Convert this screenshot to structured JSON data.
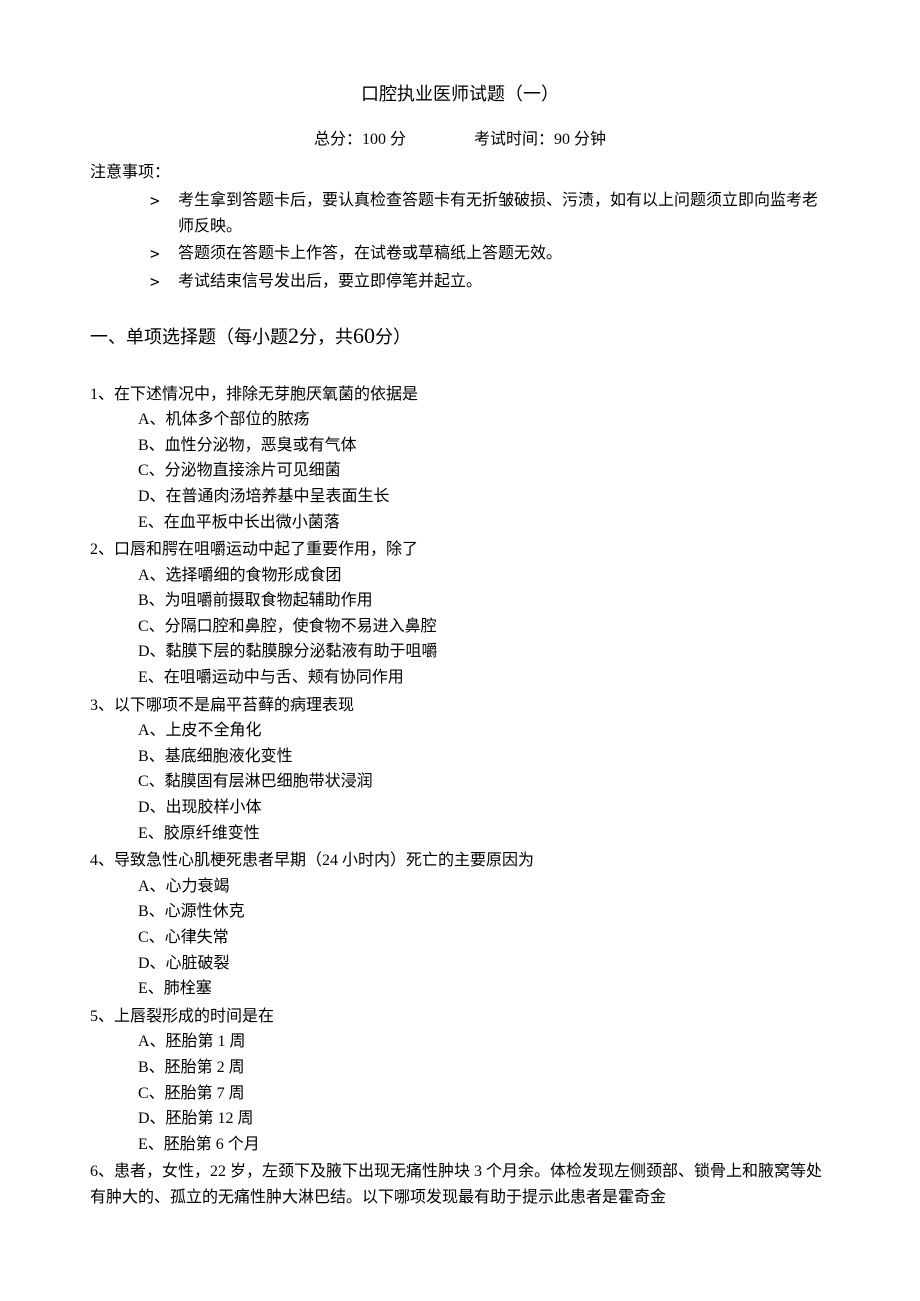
{
  "title": "口腔执业医师试题（一）",
  "meta": {
    "total_score_label": "总分：",
    "total_score_value": "100 分",
    "time_label": "考试时间：",
    "time_value": "90 分钟"
  },
  "notice_label": "注意事项：",
  "instructions": [
    "考生拿到答题卡后，要认真检查答题卡有无折皱破损、污渍，如有以上问题须立即向监考老师反映。",
    "答题须在答题卡上作答，在试卷或草稿纸上答题无效。",
    "考试结束信号发出后，要立即停笔并起立。"
  ],
  "section_heading": {
    "prefix": "一、单项选择题（每小题",
    "points": "2",
    "mid": "分，共",
    "total": "60",
    "suffix": "分）"
  },
  "questions": [
    {
      "stem": "1、在下述情况中，排除无芽胞厌氧菌的依据是",
      "options": [
        "A、机体多个部位的脓疡",
        "B、血性分泌物，恶臭或有气体",
        "C、分泌物直接涂片可见细菌",
        "D、在普通肉汤培养基中呈表面生长",
        "E、在血平板中长出微小菌落"
      ]
    },
    {
      "stem": "2、口唇和腭在咀嚼运动中起了重要作用，除了",
      "options": [
        "A、选择嚼细的食物形成食团",
        "B、为咀嚼前摄取食物起辅助作用",
        "C、分隔口腔和鼻腔，使食物不易进入鼻腔",
        "D、黏膜下层的黏膜腺分泌黏液有助于咀嚼",
        "E、在咀嚼运动中与舌、颊有协同作用"
      ]
    },
    {
      "stem": "3、以下哪项不是扁平苔藓的病理表现",
      "options": [
        "A、上皮不全角化",
        "B、基底细胞液化变性",
        "C、黏膜固有层淋巴细胞带状浸润",
        "D、出现胶样小体",
        "E、胶原纤维变性"
      ]
    },
    {
      "stem": "4、导致急性心肌梗死患者早期（24 小时内）死亡的主要原因为",
      "options": [
        "A、心力衰竭",
        "B、心源性休克",
        "C、心律失常",
        "D、心脏破裂",
        "E、肺栓塞"
      ]
    },
    {
      "stem": "5、上唇裂形成的时间是在",
      "options": [
        "A、胚胎第 1 周",
        "B、胚胎第 2 周",
        "C、胚胎第 7 周",
        "D、胚胎第 12 周",
        "E、胚胎第 6 个月"
      ]
    },
    {
      "stem": "6、患者，女性，22 岁，左颈下及腋下出现无痛性肿块 3 个月余。体检发现左侧颈部、锁骨上和腋窝等处有肿大的、孤立的无痛性肿大淋巴结。以下哪项发现最有助于提示此患者是霍奇金",
      "options": []
    }
  ]
}
